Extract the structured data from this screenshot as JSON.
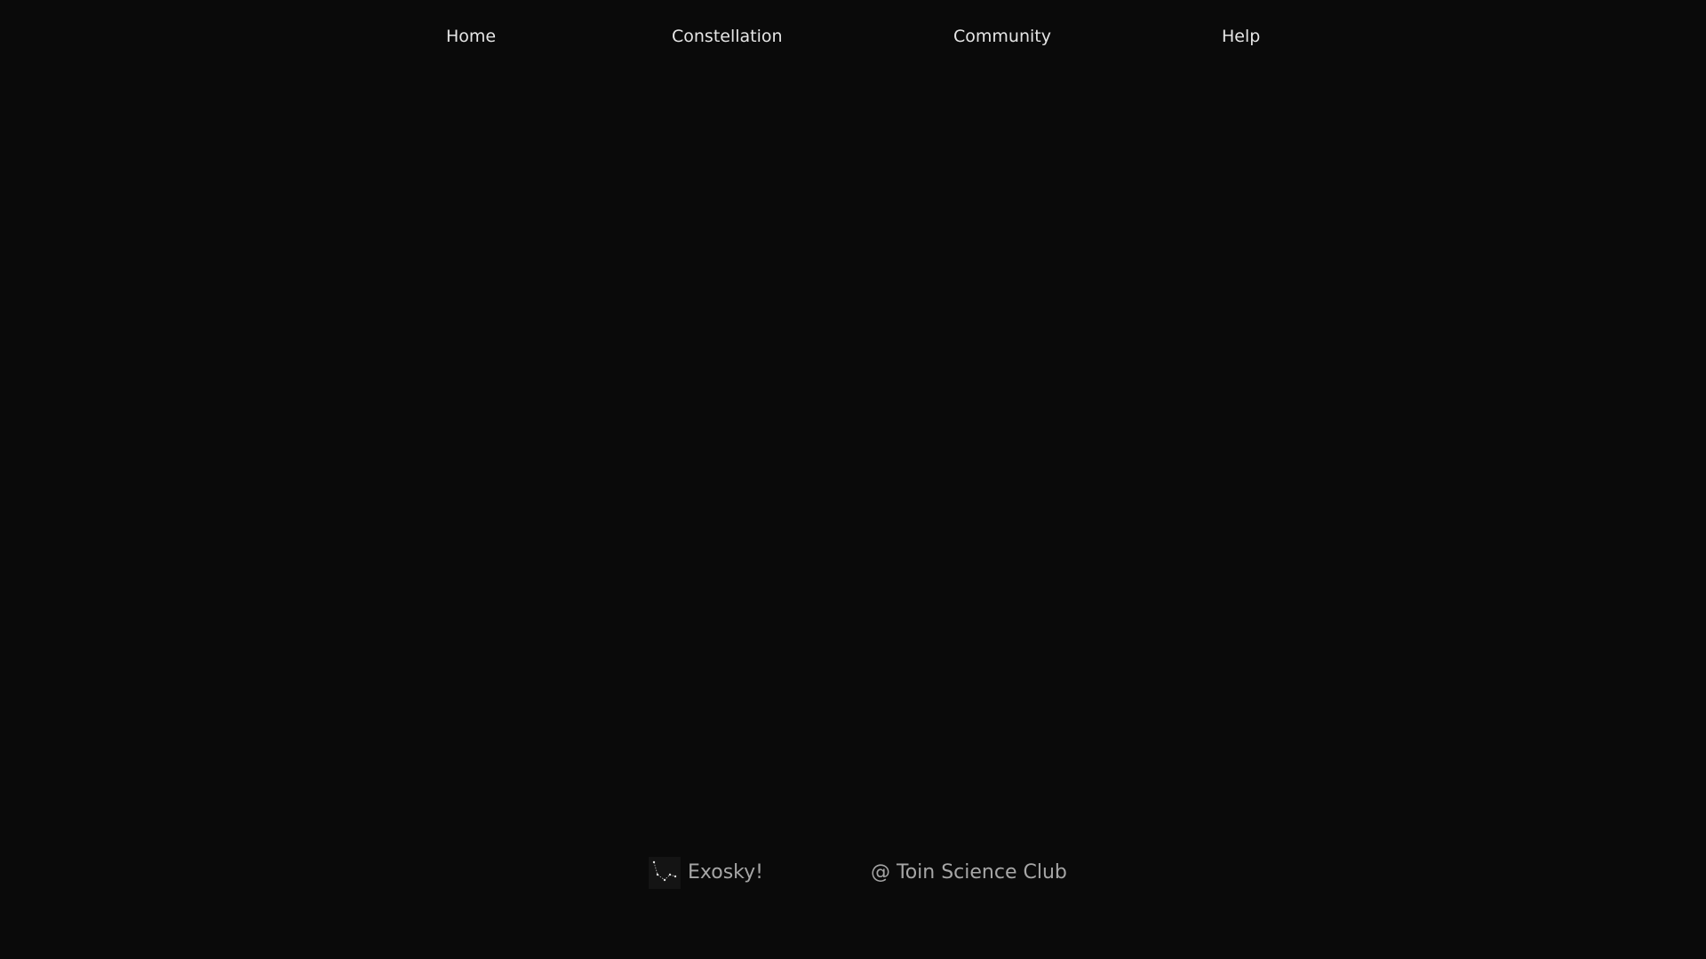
{
  "nav": {
    "items": [
      {
        "label": "Home"
      },
      {
        "label": "Constellation"
      },
      {
        "label": "Community"
      },
      {
        "label": "Help"
      }
    ]
  },
  "footer": {
    "brand_name": "Exosky!",
    "credit": "@ Toin Science Club",
    "logo_icon": "constellation-icon"
  },
  "colors": {
    "background": "#0a0a0a",
    "nav_text": "#e6e6e6",
    "footer_text": "#a6a6a6"
  }
}
